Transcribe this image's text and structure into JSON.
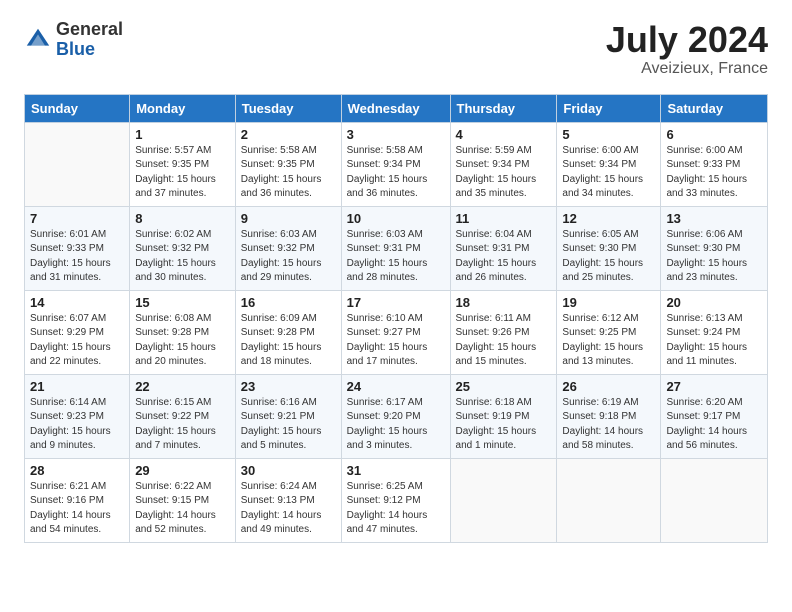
{
  "logo": {
    "general": "General",
    "blue": "Blue"
  },
  "title": "July 2024",
  "location": "Aveizieux, France",
  "header_days": [
    "Sunday",
    "Monday",
    "Tuesday",
    "Wednesday",
    "Thursday",
    "Friday",
    "Saturday"
  ],
  "weeks": [
    [
      {
        "day": "",
        "info": ""
      },
      {
        "day": "1",
        "info": "Sunrise: 5:57 AM\nSunset: 9:35 PM\nDaylight: 15 hours\nand 37 minutes."
      },
      {
        "day": "2",
        "info": "Sunrise: 5:58 AM\nSunset: 9:35 PM\nDaylight: 15 hours\nand 36 minutes."
      },
      {
        "day": "3",
        "info": "Sunrise: 5:58 AM\nSunset: 9:34 PM\nDaylight: 15 hours\nand 36 minutes."
      },
      {
        "day": "4",
        "info": "Sunrise: 5:59 AM\nSunset: 9:34 PM\nDaylight: 15 hours\nand 35 minutes."
      },
      {
        "day": "5",
        "info": "Sunrise: 6:00 AM\nSunset: 9:34 PM\nDaylight: 15 hours\nand 34 minutes."
      },
      {
        "day": "6",
        "info": "Sunrise: 6:00 AM\nSunset: 9:33 PM\nDaylight: 15 hours\nand 33 minutes."
      }
    ],
    [
      {
        "day": "7",
        "info": "Sunrise: 6:01 AM\nSunset: 9:33 PM\nDaylight: 15 hours\nand 31 minutes."
      },
      {
        "day": "8",
        "info": "Sunrise: 6:02 AM\nSunset: 9:32 PM\nDaylight: 15 hours\nand 30 minutes."
      },
      {
        "day": "9",
        "info": "Sunrise: 6:03 AM\nSunset: 9:32 PM\nDaylight: 15 hours\nand 29 minutes."
      },
      {
        "day": "10",
        "info": "Sunrise: 6:03 AM\nSunset: 9:31 PM\nDaylight: 15 hours\nand 28 minutes."
      },
      {
        "day": "11",
        "info": "Sunrise: 6:04 AM\nSunset: 9:31 PM\nDaylight: 15 hours\nand 26 minutes."
      },
      {
        "day": "12",
        "info": "Sunrise: 6:05 AM\nSunset: 9:30 PM\nDaylight: 15 hours\nand 25 minutes."
      },
      {
        "day": "13",
        "info": "Sunrise: 6:06 AM\nSunset: 9:30 PM\nDaylight: 15 hours\nand 23 minutes."
      }
    ],
    [
      {
        "day": "14",
        "info": "Sunrise: 6:07 AM\nSunset: 9:29 PM\nDaylight: 15 hours\nand 22 minutes."
      },
      {
        "day": "15",
        "info": "Sunrise: 6:08 AM\nSunset: 9:28 PM\nDaylight: 15 hours\nand 20 minutes."
      },
      {
        "day": "16",
        "info": "Sunrise: 6:09 AM\nSunset: 9:28 PM\nDaylight: 15 hours\nand 18 minutes."
      },
      {
        "day": "17",
        "info": "Sunrise: 6:10 AM\nSunset: 9:27 PM\nDaylight: 15 hours\nand 17 minutes."
      },
      {
        "day": "18",
        "info": "Sunrise: 6:11 AM\nSunset: 9:26 PM\nDaylight: 15 hours\nand 15 minutes."
      },
      {
        "day": "19",
        "info": "Sunrise: 6:12 AM\nSunset: 9:25 PM\nDaylight: 15 hours\nand 13 minutes."
      },
      {
        "day": "20",
        "info": "Sunrise: 6:13 AM\nSunset: 9:24 PM\nDaylight: 15 hours\nand 11 minutes."
      }
    ],
    [
      {
        "day": "21",
        "info": "Sunrise: 6:14 AM\nSunset: 9:23 PM\nDaylight: 15 hours\nand 9 minutes."
      },
      {
        "day": "22",
        "info": "Sunrise: 6:15 AM\nSunset: 9:22 PM\nDaylight: 15 hours\nand 7 minutes."
      },
      {
        "day": "23",
        "info": "Sunrise: 6:16 AM\nSunset: 9:21 PM\nDaylight: 15 hours\nand 5 minutes."
      },
      {
        "day": "24",
        "info": "Sunrise: 6:17 AM\nSunset: 9:20 PM\nDaylight: 15 hours\nand 3 minutes."
      },
      {
        "day": "25",
        "info": "Sunrise: 6:18 AM\nSunset: 9:19 PM\nDaylight: 15 hours\nand 1 minute."
      },
      {
        "day": "26",
        "info": "Sunrise: 6:19 AM\nSunset: 9:18 PM\nDaylight: 14 hours\nand 58 minutes."
      },
      {
        "day": "27",
        "info": "Sunrise: 6:20 AM\nSunset: 9:17 PM\nDaylight: 14 hours\nand 56 minutes."
      }
    ],
    [
      {
        "day": "28",
        "info": "Sunrise: 6:21 AM\nSunset: 9:16 PM\nDaylight: 14 hours\nand 54 minutes."
      },
      {
        "day": "29",
        "info": "Sunrise: 6:22 AM\nSunset: 9:15 PM\nDaylight: 14 hours\nand 52 minutes."
      },
      {
        "day": "30",
        "info": "Sunrise: 6:24 AM\nSunset: 9:13 PM\nDaylight: 14 hours\nand 49 minutes."
      },
      {
        "day": "31",
        "info": "Sunrise: 6:25 AM\nSunset: 9:12 PM\nDaylight: 14 hours\nand 47 minutes."
      },
      {
        "day": "",
        "info": ""
      },
      {
        "day": "",
        "info": ""
      },
      {
        "day": "",
        "info": ""
      }
    ]
  ]
}
